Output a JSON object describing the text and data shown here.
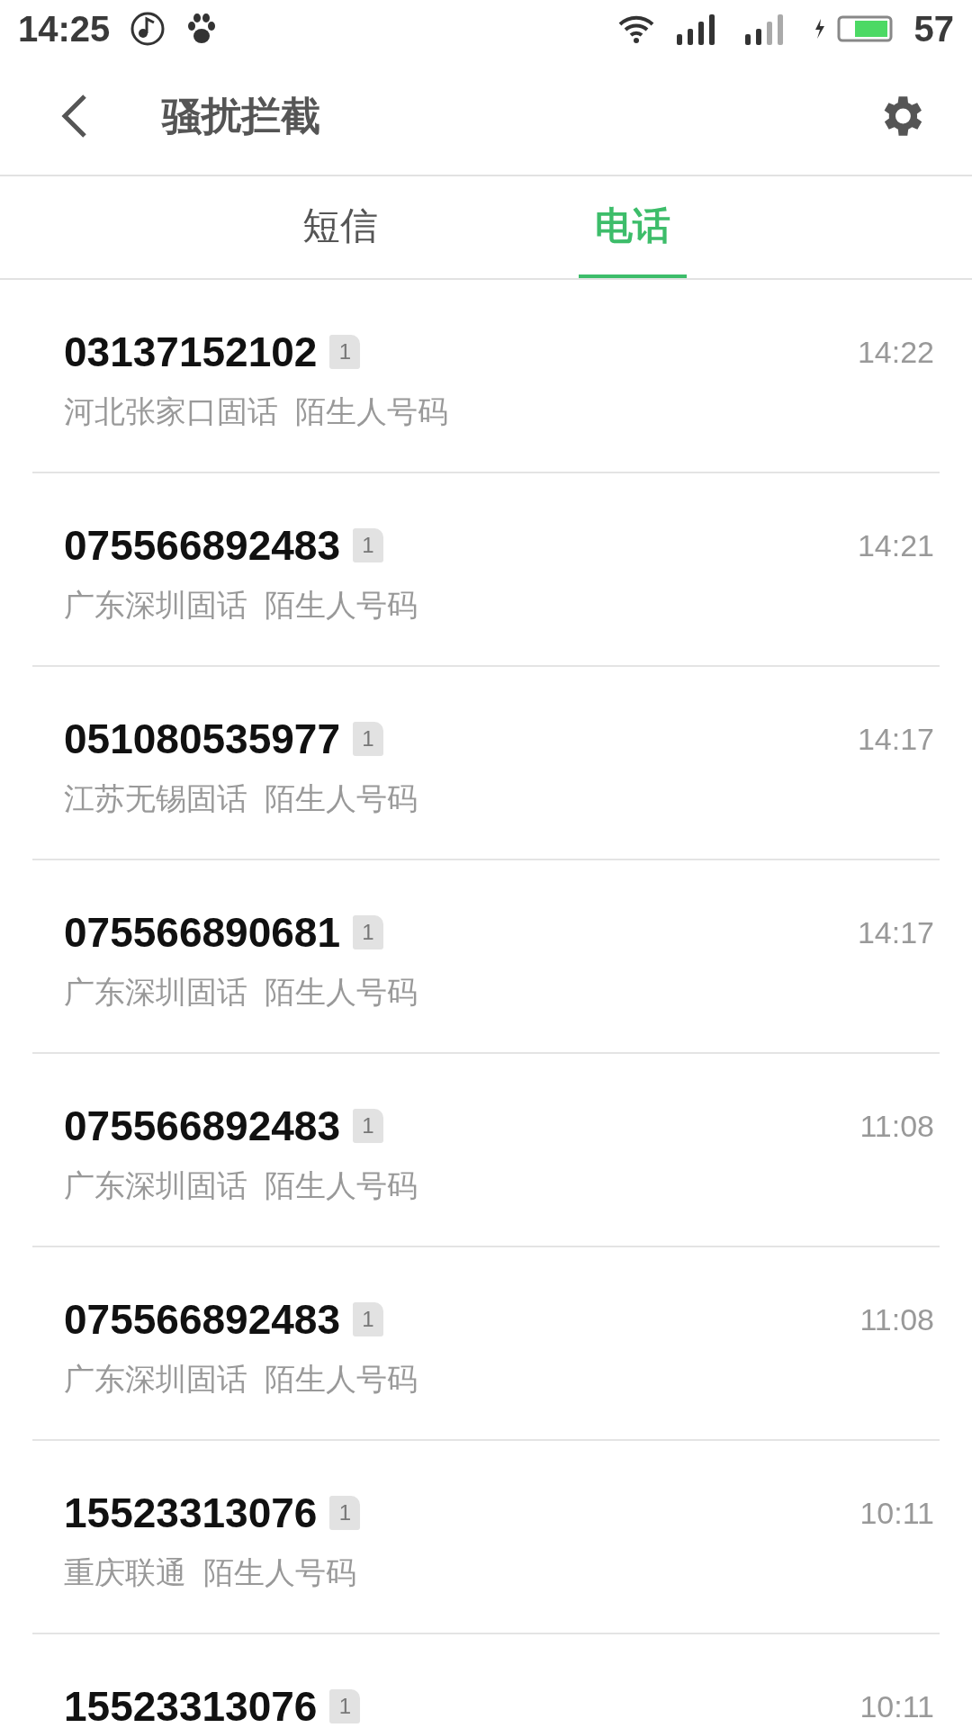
{
  "status_bar": {
    "time": "14:25",
    "battery": "57"
  },
  "header": {
    "title": "骚扰拦截"
  },
  "tabs": [
    {
      "label": "短信",
      "selected": false
    },
    {
      "label": "电话",
      "selected": true
    }
  ],
  "calls": [
    {
      "number": "03137152102",
      "sim": "1",
      "location": "河北张家口固话  陌生人号码",
      "time": "14:22"
    },
    {
      "number": "075566892483",
      "sim": "1",
      "location": "广东深圳固话  陌生人号码",
      "time": "14:21"
    },
    {
      "number": "051080535977",
      "sim": "1",
      "location": "江苏无锡固话  陌生人号码",
      "time": "14:17"
    },
    {
      "number": "075566890681",
      "sim": "1",
      "location": "广东深圳固话  陌生人号码",
      "time": "14:17"
    },
    {
      "number": "075566892483",
      "sim": "1",
      "location": "广东深圳固话  陌生人号码",
      "time": "11:08"
    },
    {
      "number": "075566892483",
      "sim": "1",
      "location": "广东深圳固话  陌生人号码",
      "time": "11:08"
    },
    {
      "number": "15523313076",
      "sim": "1",
      "location": "重庆联通  陌生人号码",
      "time": "10:11"
    },
    {
      "number": "15523313076",
      "sim": "1",
      "time": "10:11"
    }
  ]
}
